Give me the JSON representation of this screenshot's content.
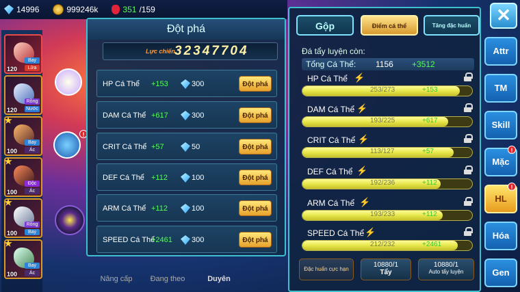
{
  "resources": {
    "gems": "14996",
    "coins": "999246k",
    "potion_current": "351",
    "potion_max": "/159"
  },
  "roster": [
    {
      "level": "120",
      "elements": [
        "Bay",
        "Lửa"
      ]
    },
    {
      "level": "120",
      "elements": [
        "Rồng",
        "Nước"
      ]
    },
    {
      "level": "100",
      "elements": [
        "Bay",
        "Ác"
      ]
    },
    {
      "level": "100",
      "elements": [
        "Độc",
        "Ác"
      ]
    },
    {
      "level": "100",
      "elements": [
        "Rồng",
        "Bay"
      ]
    },
    {
      "level": "100",
      "elements": [
        "Bay",
        "Ác"
      ]
    }
  ],
  "breakthrough": {
    "title": "Đột phá",
    "power_label": "Lực chiến",
    "power_value": "32347704",
    "button_label": "Đột phá",
    "rows": [
      {
        "name": "HP Cá Thể",
        "bonus": "+153",
        "cost": "300"
      },
      {
        "name": "DAM Cá Thể",
        "bonus": "+617",
        "cost": "300"
      },
      {
        "name": "CRIT Cá Thể",
        "bonus": "+57",
        "cost": "50"
      },
      {
        "name": "DEF Cá Thể",
        "bonus": "+112",
        "cost": "100"
      },
      {
        "name": "ARM Cá Thể",
        "bonus": "+112",
        "cost": "100"
      },
      {
        "name": "SPEED Cá Thể",
        "bonus": "+2461",
        "cost": "300"
      }
    ]
  },
  "bottom_nav": [
    "Nâng cấp",
    "Đang theo",
    "Duyên"
  ],
  "tabs": {
    "merge": "Gộp",
    "points": "Điểm cá thể",
    "special": "Tăng đặc huấn"
  },
  "training": {
    "remaining_label": "Đá tẩy luyện còn:",
    "total_label": "Tổng Cá Thể:",
    "total_value": "1156",
    "total_bonus": "+3512",
    "stats": [
      {
        "name": "HP Cá Thể",
        "current": 253,
        "max": 273,
        "text": "253/273",
        "bonus": "+153"
      },
      {
        "name": "DAM Cá Thể",
        "current": 193,
        "max": 225,
        "text": "193/225",
        "bonus": "+617"
      },
      {
        "name": "CRIT Cá Thể",
        "current": 113,
        "max": 127,
        "text": "113/127",
        "bonus": "+57"
      },
      {
        "name": "DEF Cá Thể",
        "current": 192,
        "max": 236,
        "text": "192/236",
        "bonus": "+112"
      },
      {
        "name": "ARM Cá Thể",
        "current": 193,
        "max": 233,
        "text": "193/233",
        "bonus": "+112"
      },
      {
        "name": "SPEED Cá Thể",
        "current": 212,
        "max": 232,
        "text": "212/232",
        "bonus": "+2461"
      }
    ],
    "actions": {
      "special": "Đặc huấn cực hạn",
      "wash_count": "10880/1",
      "wash": "Tẩy",
      "auto_count": "10880/1",
      "auto": "Auto tẩy luyện"
    }
  },
  "side_menu": [
    "Attr",
    "TM",
    "Skill",
    "Mặc",
    "HL",
    "Hóa",
    "Gen"
  ],
  "colors": {
    "accent": "#3ec0d0",
    "gold": "#e7a12c",
    "green": "#56ff56"
  }
}
